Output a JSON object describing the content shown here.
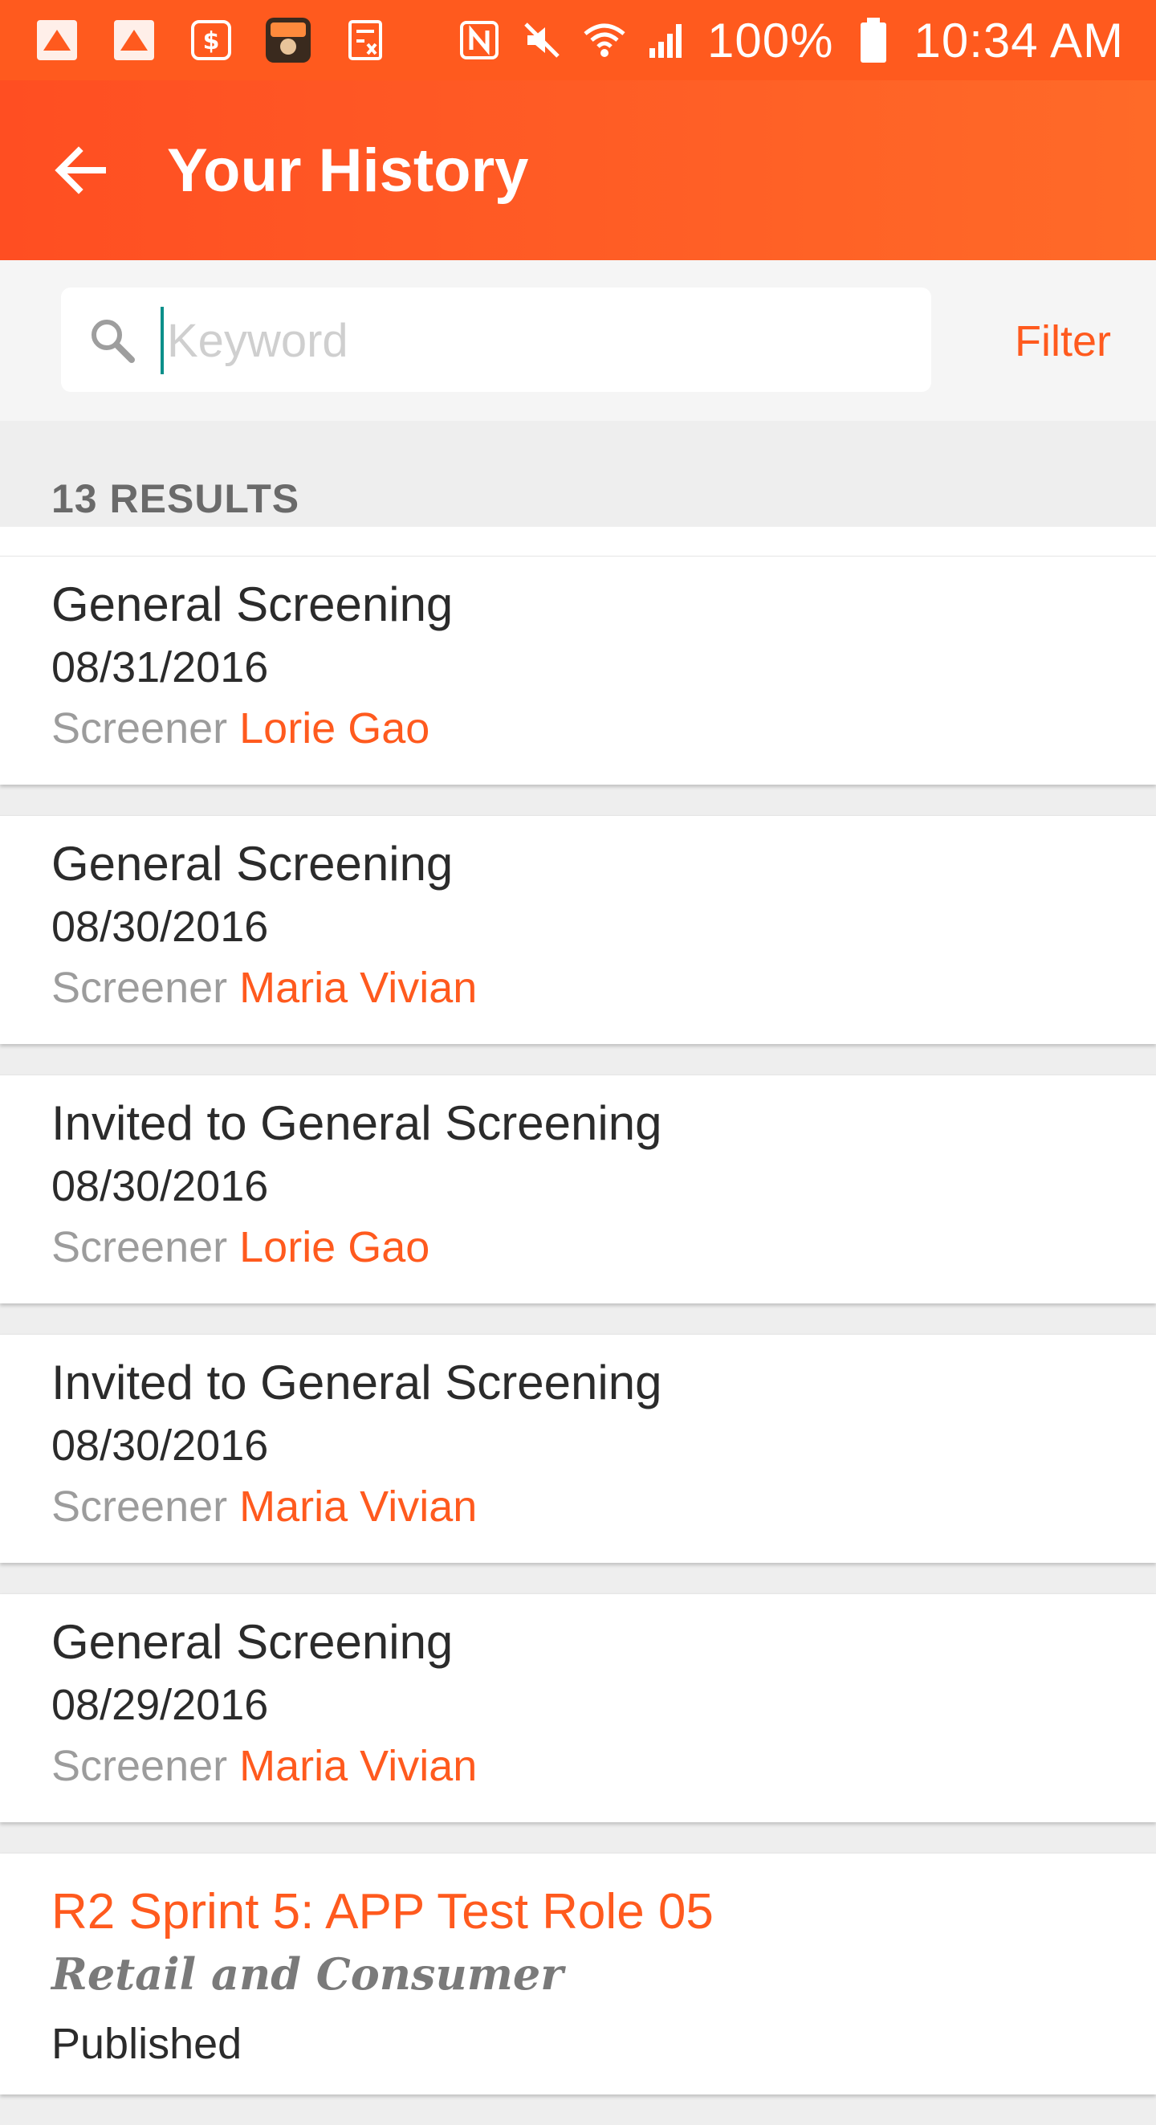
{
  "status_bar": {
    "battery": "100%",
    "time": "10:34 AM",
    "notification_icons": [
      "app-icon",
      "app-icon",
      "dollar-icon",
      "game-icon",
      "calculator-icon"
    ],
    "system_icons": [
      "nfc-icon",
      "mute-icon",
      "wifi-icon",
      "signal-icon",
      "battery-icon"
    ]
  },
  "app_bar": {
    "title": "Your History",
    "back_icon": "back-arrow-icon"
  },
  "search": {
    "placeholder": "Keyword",
    "value": "",
    "filter_label": "Filter"
  },
  "results": {
    "count_label": "13 RESULTS",
    "items": [
      {
        "title": "General Screening",
        "date": "08/31/2016",
        "screener_label": "Screener",
        "screener_name": "Lorie Gao"
      },
      {
        "title": "General Screening",
        "date": "08/30/2016",
        "screener_label": "Screener",
        "screener_name": "Maria Vivian"
      },
      {
        "title": "Invited to General Screening",
        "date": "08/30/2016",
        "screener_label": "Screener",
        "screener_name": "Lorie Gao"
      },
      {
        "title": "Invited to General Screening",
        "date": "08/30/2016",
        "screener_label": "Screener",
        "screener_name": "Maria Vivian"
      },
      {
        "title": "General Screening",
        "date": "08/29/2016",
        "screener_label": "Screener",
        "screener_name": "Maria Vivian"
      }
    ],
    "last_item": {
      "title": "R2 Sprint 5: APP Test Role 05",
      "subtitle": "Retail and Consumer",
      "status": "Published"
    }
  },
  "colors": {
    "accent": "#ff5a1e",
    "text": "#2b2b2b",
    "muted": "#9c9c9c"
  }
}
